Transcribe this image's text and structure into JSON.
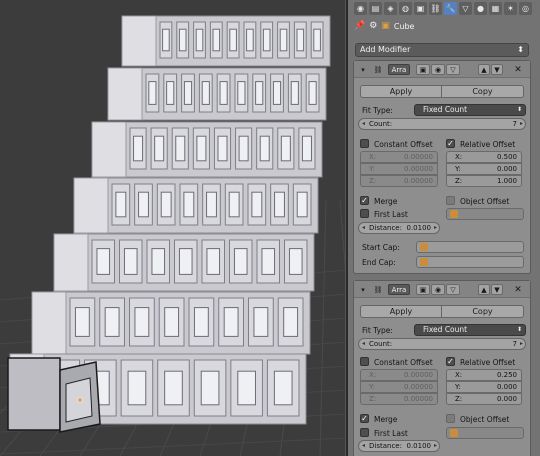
{
  "header": {
    "object_name": "Cube",
    "tabs": [
      "render-icon",
      "layers-icon",
      "scene-icon",
      "world-icon",
      "object-icon",
      "constraints-icon",
      "modifiers-icon",
      "data-icon",
      "material-icon",
      "texture-icon",
      "particles-icon",
      "physics-icon"
    ]
  },
  "add_modifier_label": "Add Modifier",
  "modifiers": [
    {
      "name": "Arra",
      "apply_label": "Apply",
      "copy_label": "Copy",
      "fit_type_label": "Fit Type:",
      "fit_type_value": "Fixed Count",
      "count_label": "Count:",
      "count_value": "7",
      "constant_offset_label": "Constant Offset",
      "constant_offset_checked": false,
      "relative_offset_label": "Relative Offset",
      "relative_offset_checked": true,
      "constant": [
        {
          "axis": "X:",
          "value": "0.00000"
        },
        {
          "axis": "Y:",
          "value": "0.00000"
        },
        {
          "axis": "Z:",
          "value": "0.00000"
        }
      ],
      "relative": [
        {
          "axis": "X:",
          "value": "0.500"
        },
        {
          "axis": "Y:",
          "value": "0.000"
        },
        {
          "axis": "Z:",
          "value": "1.000"
        }
      ],
      "merge_label": "Merge",
      "merge_checked": true,
      "first_last_label": "First Last",
      "first_last_checked": false,
      "object_offset_label": "Object Offset",
      "object_offset_checked": false,
      "distance_label": "Distance:",
      "distance_value": "0.0100",
      "start_cap_label": "Start Cap:",
      "end_cap_label": "End Cap:"
    },
    {
      "name": "Arra",
      "apply_label": "Apply",
      "copy_label": "Copy",
      "fit_type_label": "Fit Type:",
      "fit_type_value": "Fixed Count",
      "count_label": "Count:",
      "count_value": "7",
      "constant_offset_label": "Constant Offset",
      "constant_offset_checked": false,
      "relative_offset_label": "Relative Offset",
      "relative_offset_checked": true,
      "constant": [
        {
          "axis": "X:",
          "value": "0.00000"
        },
        {
          "axis": "Y:",
          "value": "0.00000"
        },
        {
          "axis": "Z:",
          "value": "0.00000"
        }
      ],
      "relative": [
        {
          "axis": "X:",
          "value": "0.250"
        },
        {
          "axis": "Y:",
          "value": "0.000"
        },
        {
          "axis": "Z:",
          "value": "0.000"
        }
      ],
      "merge_label": "Merge",
      "merge_checked": true,
      "first_last_label": "First Last",
      "first_last_checked": false,
      "object_offset_label": "Object Offset",
      "object_offset_checked": false,
      "distance_label": "Distance:",
      "distance_value": "0.0100"
    }
  ],
  "colors": {
    "viewport_bg": "#3c3c3c",
    "panel_bg": "#737373",
    "accent": "#5680c2",
    "object_orange": "#c98d3b"
  }
}
